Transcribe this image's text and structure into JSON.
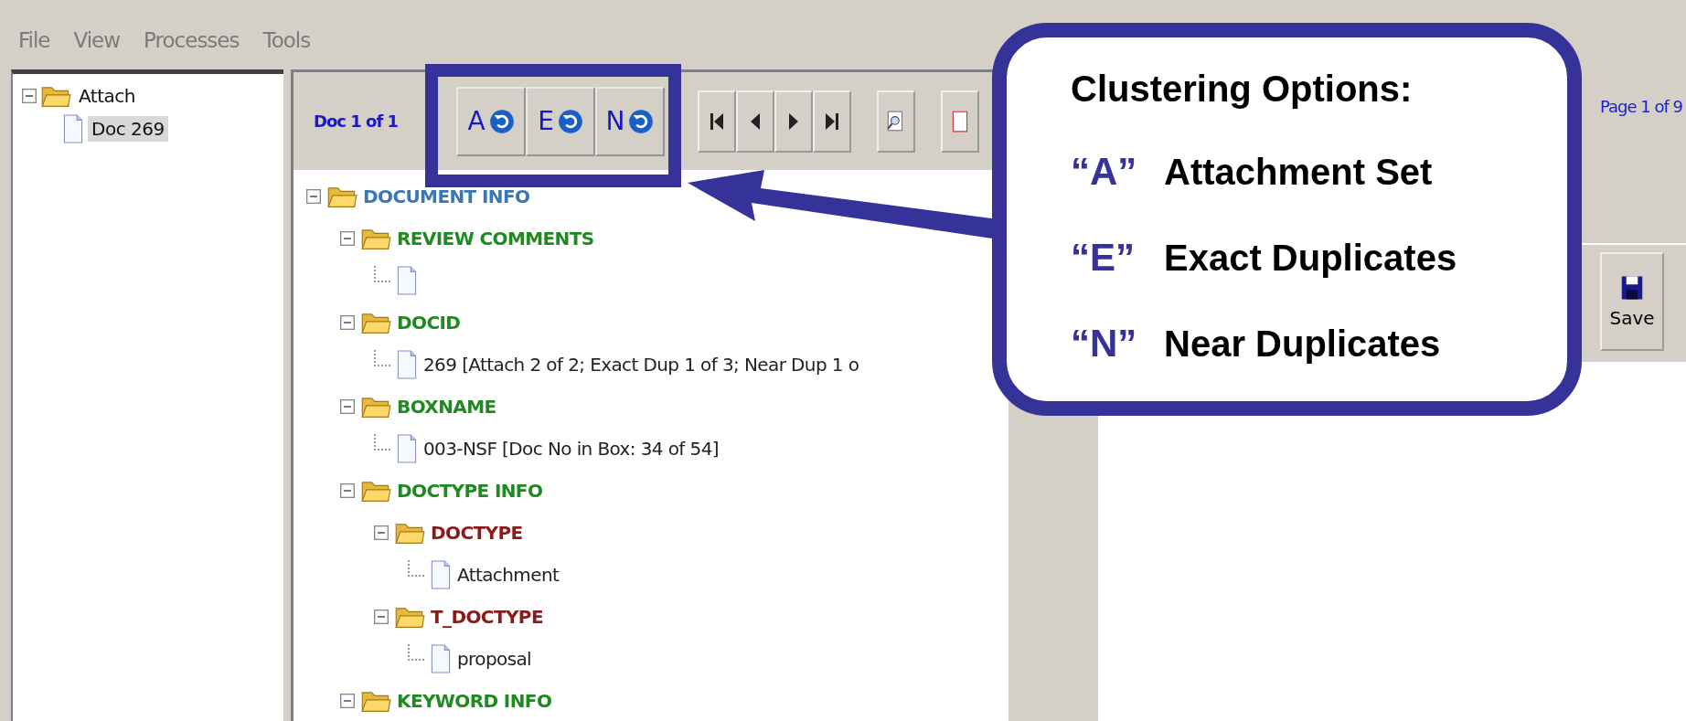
{
  "menu": [
    {
      "label": "File"
    },
    {
      "label": "View"
    },
    {
      "label": "Processes"
    },
    {
      "label": "Tools"
    }
  ],
  "left_tree": [
    {
      "label": "Attach",
      "kind": "folder",
      "expanded": true,
      "children": [
        {
          "label": "Doc 269",
          "kind": "document",
          "selected": true
        }
      ]
    }
  ],
  "toolbar": {
    "doc_counter": "Doc 1 of 1",
    "cluster_buttons": [
      {
        "label": "A"
      },
      {
        "label": "E"
      },
      {
        "label": "N"
      }
    ]
  },
  "tree": [
    {
      "label": "DOCUMENT INFO",
      "kind": "folder",
      "color": "#3a78b5",
      "expanded": true,
      "children": [
        {
          "label": "REVIEW COMMENTS",
          "kind": "folder",
          "color": "#1f8a1f",
          "expanded": true,
          "children": [
            {
              "kind": "document"
            }
          ]
        },
        {
          "label": "DOCID",
          "kind": "folder",
          "color": "#1f8a1f",
          "expanded": true,
          "children": [
            {
              "label": "269 [Attach 2 of 2; Exact Dup 1 of 3; Near Dup 1 o",
              "kind": "document"
            }
          ]
        },
        {
          "label": "BOXNAME",
          "kind": "folder",
          "color": "#1f8a1f",
          "expanded": true,
          "children": [
            {
              "label": "003-NSF [Doc No in Box: 34 of 54]",
              "kind": "document"
            }
          ]
        },
        {
          "label": "DOCTYPE INFO",
          "kind": "folder",
          "color": "#1f8a1f",
          "expanded": true,
          "children": [
            {
              "label": "DOCTYPE",
              "kind": "folder",
              "color": "#8b1a1a",
              "expanded": true,
              "children": [
                {
                  "label": "Attachment",
                  "kind": "document"
                }
              ]
            },
            {
              "label": "T_DOCTYPE",
              "kind": "folder",
              "color": "#8b1a1a",
              "expanded": true,
              "children": [
                {
                  "label": "proposal",
                  "kind": "document"
                }
              ]
            }
          ]
        },
        {
          "label": "KEYWORD INFO",
          "kind": "folder",
          "color": "#1f8a1f",
          "expanded": true
        }
      ]
    }
  ],
  "viewer": {
    "page_counter": "Page 1 of 9",
    "buttons": [
      {
        "label": "Save"
      }
    ]
  },
  "callout": {
    "title": "Clustering Options:",
    "items": [
      {
        "key": "“A”",
        "text": "Attachment Set"
      },
      {
        "key": "“E”",
        "text": "Exact Duplicates"
      },
      {
        "key": "“N”",
        "text": "Near Duplicates"
      }
    ]
  }
}
